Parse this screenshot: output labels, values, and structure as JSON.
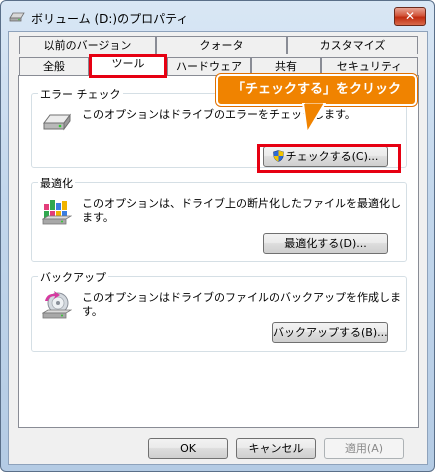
{
  "window": {
    "title": "ボリューム (D:)のプロパティ",
    "close_label": "✕"
  },
  "tabs_top": [
    {
      "label": "以前のバージョン"
    },
    {
      "label": "クォータ"
    },
    {
      "label": "カスタマイズ"
    }
  ],
  "tabs_bottom": [
    {
      "label": "全般"
    },
    {
      "label": "ツール"
    },
    {
      "label": "ハードウェア"
    },
    {
      "label": "共有"
    },
    {
      "label": "セキュリティ"
    }
  ],
  "active_tab": "ツール",
  "callout": {
    "text": "「チェックする」をクリック"
  },
  "groups": {
    "error_check": {
      "title": "エラー チェック",
      "desc": "このオプションはドライブのエラーをチェックします。",
      "button": "チェックする(C)..."
    },
    "optimize": {
      "title": "最適化",
      "desc": "このオプションは、ドライブ上の断片化したファイルを最適化します。",
      "button": "最適化する(D)..."
    },
    "backup": {
      "title": "バックアップ",
      "desc": "このオプションはドライブのファイルのバックアップを作成します。",
      "button": "バックアップする(B)..."
    }
  },
  "footer": {
    "ok": "OK",
    "cancel": "キャンセル",
    "apply": "適用(A)"
  },
  "colors": {
    "highlight": "#e60012",
    "callout": "#f08300"
  },
  "icons": {
    "title": "drive-icon",
    "error_check": "hard-drive-icon",
    "optimize": "defrag-icon",
    "backup": "backup-icon",
    "button": "uac-shield-icon"
  }
}
